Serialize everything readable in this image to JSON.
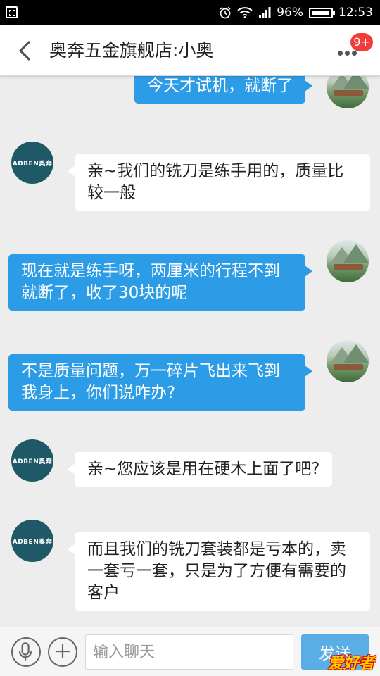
{
  "status_bar": {
    "battery_percent": "96%",
    "time": "12:53",
    "icons": [
      "screenshot-icon",
      "alarm-icon",
      "wifi-icon",
      "signal-icon",
      "battery-icon"
    ]
  },
  "header": {
    "title": "奥奔五金旗舰店:小奥",
    "badge": "9+",
    "back_icon": "chevron-left-icon",
    "more_icon": "more-dots-icon"
  },
  "messages": [
    {
      "from": "user",
      "text": "今天才试机，就断了"
    },
    {
      "from": "shop",
      "text": "亲~我们的铣刀是练手用的，质量比较一般"
    },
    {
      "from": "user",
      "text": "现在就是练手呀，两厘米的行程不到就断了，收了30块的呢"
    },
    {
      "from": "user",
      "text": "不是质量问题，万一碎片飞出来飞到我身上，你们说咋办?"
    },
    {
      "from": "shop",
      "text": "亲~您应该是用在硬木上面了吧?"
    },
    {
      "from": "shop",
      "text": "而且我们的铣刀套装都是亏本的，卖一套亏一套，只是为了方便有需要的客户"
    }
  ],
  "shop_avatar_logo": "ADBEN奥奔",
  "input_bar": {
    "placeholder": "输入聊天",
    "send_label": "发送",
    "watermark": "爱好者"
  },
  "colors": {
    "outgoing_bubble": "#2d9ce6",
    "incoming_bubble": "#ffffff",
    "background": "#ededed",
    "badge": "#f23b3b",
    "send_button": "#5aaee6"
  }
}
